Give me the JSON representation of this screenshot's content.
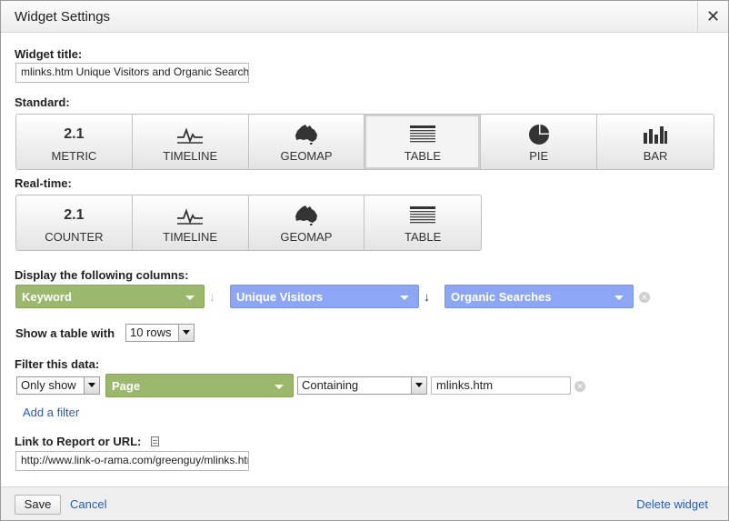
{
  "dialog": {
    "title": "Widget Settings",
    "close_glyph": "✕"
  },
  "widget_title": {
    "label": "Widget title:",
    "value": "mlinks.htm Unique Visitors and Organic Searches"
  },
  "standard": {
    "label": "Standard:",
    "selected": "TABLE",
    "buttons": [
      {
        "icon_text": "2.1",
        "icon": "metric-number",
        "label": "METRIC"
      },
      {
        "icon": "timeline-icon",
        "label": "TIMELINE"
      },
      {
        "icon": "australia-map-icon",
        "label": "GEOMAP"
      },
      {
        "icon": "table-icon",
        "label": "TABLE"
      },
      {
        "icon": "pie-chart-icon",
        "label": "PIE"
      },
      {
        "icon": "bar-chart-icon",
        "label": "BAR"
      }
    ]
  },
  "realtime": {
    "label": "Real-time:",
    "buttons": [
      {
        "icon_text": "2.1",
        "icon": "metric-number",
        "label": "COUNTER"
      },
      {
        "icon": "timeline-icon",
        "label": "TIMELINE"
      },
      {
        "icon": "australia-map-icon",
        "label": "GEOMAP"
      },
      {
        "icon": "table-icon",
        "label": "TABLE"
      }
    ]
  },
  "columns": {
    "label": "Display the following columns:",
    "items": [
      {
        "value": "Keyword",
        "color": "#9bb86d"
      },
      {
        "value": "Unique Visitors",
        "color": "#8ea7f4"
      },
      {
        "value": "Organic Searches",
        "color": "#8ea7f4"
      }
    ],
    "arrow_glyph": "↓"
  },
  "rows": {
    "prefix": "Show a table with",
    "selected": "10 rows"
  },
  "filter": {
    "label": "Filter this data:",
    "mode": "Only show",
    "dimension": "Page",
    "match": "Containing",
    "value": "mlinks.htm",
    "add_filter": "Add a filter"
  },
  "link": {
    "label": "Link to Report or URL:",
    "value": "http://www.link-o-rama.com/greenguy/mlinks.htm"
  },
  "footer": {
    "save": "Save",
    "cancel": "Cancel",
    "delete": "Delete widget"
  },
  "colors": {
    "green_pill": "#9bb86d",
    "blue_pill": "#8ea7f4",
    "link": "#2a5db0"
  }
}
